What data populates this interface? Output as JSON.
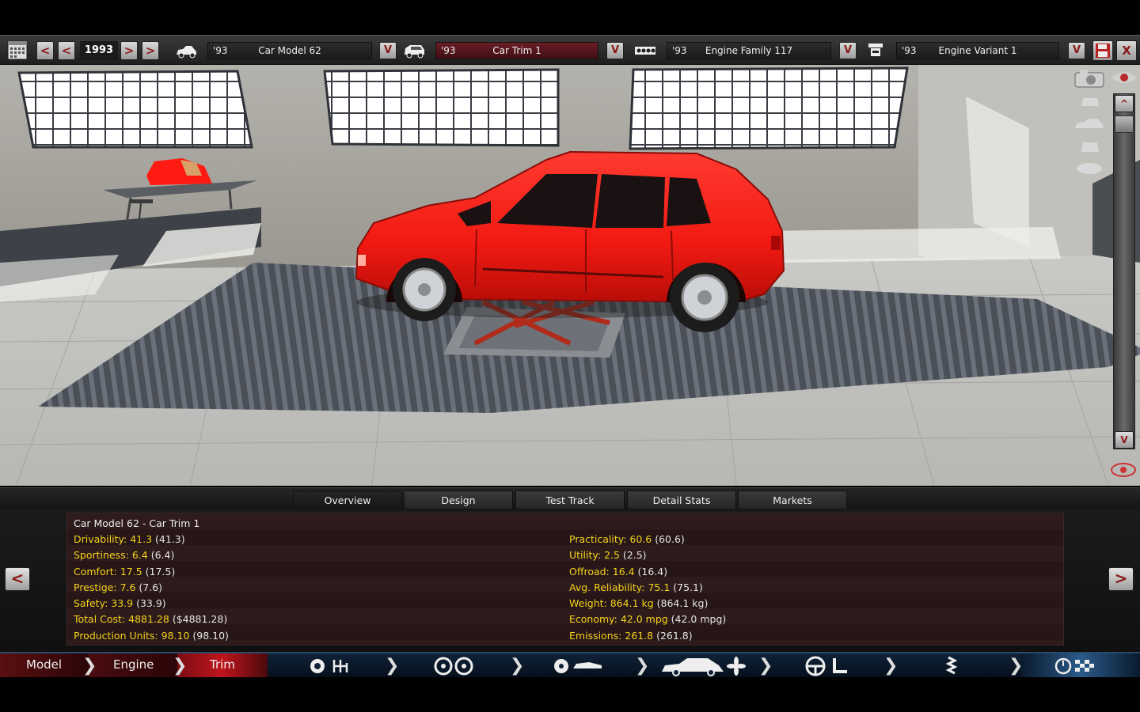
{
  "topbar": {
    "year": "1993",
    "prev_big": "<",
    "prev": "<",
    "next": ">",
    "next_big": ">",
    "car_model": {
      "year": "'93",
      "name": "Car Model 62"
    },
    "car_trim": {
      "year": "'93",
      "name": "Car Trim 1"
    },
    "engine_family": {
      "year": "'93",
      "name": "Engine Family 117"
    },
    "engine_variant": {
      "year": "'93",
      "name": "Engine Variant 1"
    },
    "dropdown": "V",
    "close": "X"
  },
  "scroll": {
    "up": "^",
    "down": "V"
  },
  "tabs": [
    {
      "label": "Overview"
    },
    {
      "label": "Design"
    },
    {
      "label": "Test Track"
    },
    {
      "label": "Detail Stats"
    },
    {
      "label": "Markets"
    }
  ],
  "stats": {
    "title": "Car Model 62 - Car Trim 1",
    "left": [
      {
        "label": "Drivability: 41.3",
        "paren": " (41.3)"
      },
      {
        "label": "Sportiness: 6.4",
        "paren": " (6.4)"
      },
      {
        "label": "Comfort: 17.5",
        "paren": " (17.5)"
      },
      {
        "label": "Prestige: 7.6",
        "paren": " (7.6)"
      },
      {
        "label": "Safety: 33.9",
        "paren": " (33.9)"
      },
      {
        "label": "Total Cost: 4881.28",
        "paren": " ($4881.28)"
      },
      {
        "label": "Production Units: 98.10",
        "paren": " (98.10)"
      }
    ],
    "right": [
      {
        "label": "Practicality: 60.6",
        "paren": " (60.6)"
      },
      {
        "label": "Utility: 2.5",
        "paren": " (2.5)"
      },
      {
        "label": "Offroad: 16.4",
        "paren": " (16.4)"
      },
      {
        "label": "Avg. Reliability: 75.1",
        "paren": " (75.1)"
      },
      {
        "label": "Weight: 864.1 kg",
        "paren": " (864.1 kg)"
      },
      {
        "label": "Economy: 42.0 mpg",
        "paren": " (42.0 mpg)"
      },
      {
        "label": "Emissions: 261.8",
        "paren": " (261.8)"
      }
    ],
    "prev": "<",
    "next": ">"
  },
  "bottomnav": {
    "model": "Model",
    "engine": "Engine",
    "trim": "Trim"
  },
  "colors": {
    "stat_label": "#f5d31a",
    "car_body": "#ff1a12",
    "accent_red": "#8a1a1a",
    "nav_blue": "#0f2238"
  }
}
